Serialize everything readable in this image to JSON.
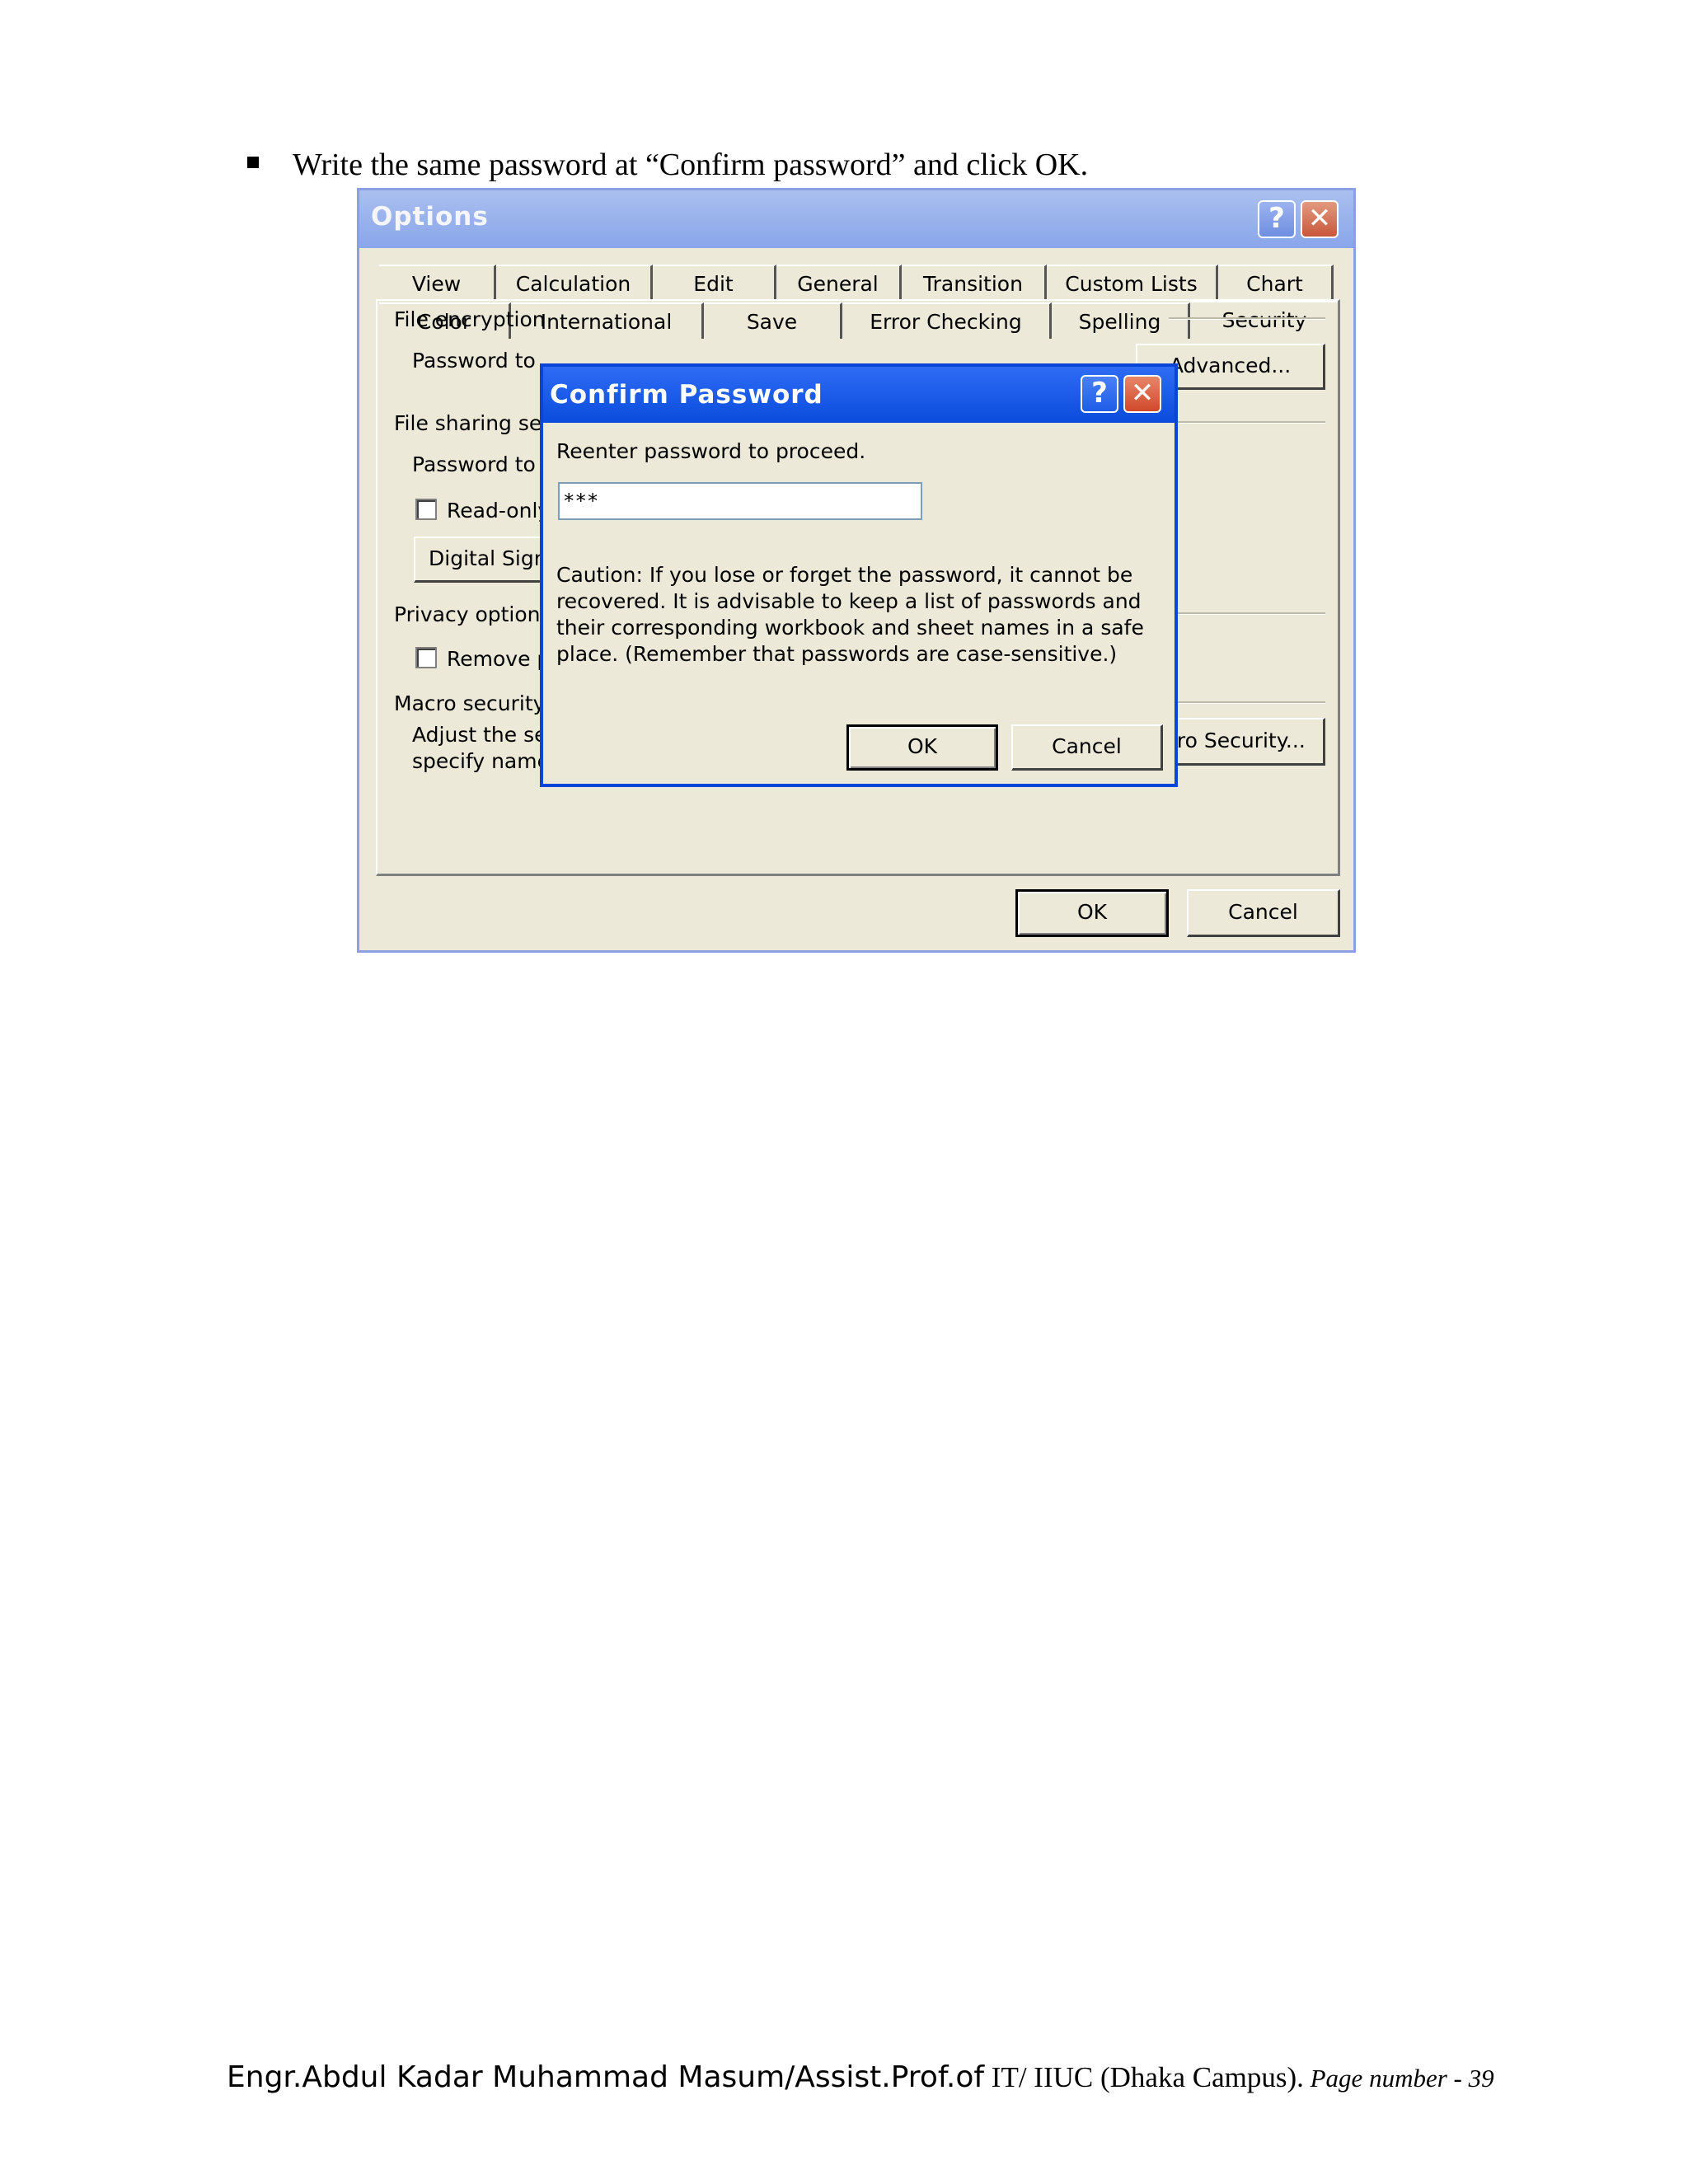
{
  "instruction": "Write the same password at “Confirm password” and click OK.",
  "options_dialog": {
    "title": "Options",
    "tabs_row1": [
      "View",
      "Calculation",
      "Edit",
      "General",
      "Transition",
      "Custom Lists",
      "Chart"
    ],
    "tabs_row2": [
      "Color",
      "International",
      "Save",
      "Error Checking",
      "Spelling",
      "Security"
    ],
    "active_tab": "Security",
    "file_encryption_label": "File encryption",
    "password_to_open_label": "Password to",
    "advanced_button": "Advanced...",
    "file_sharing_label": "File sharing set",
    "password_to_modify_label": "Password to",
    "read_only_label": "Read-only",
    "digital_signatures_button": "Digital Signa",
    "privacy_label": "Privacy options",
    "remove_label": "Remove p",
    "macro_security_label": "Macro security",
    "macro_description_line1": "Adjust the security level for files that might contain macro viruses and",
    "macro_description_line2": "specify names of trusted macro developers.",
    "macro_security_button": "Macro Security...",
    "ok_button": "OK",
    "cancel_button": "Cancel"
  },
  "confirm_dialog": {
    "title": "Confirm Password",
    "prompt": "Reenter password to proceed.",
    "password_value": "***",
    "caution_line1": "Caution: If you lose or forget the password, it cannot be",
    "caution_line2": "recovered. It is advisable to keep a list of passwords and",
    "caution_line3": "their corresponding workbook and sheet names in a safe",
    "caution_line4": "place.  (Remember that passwords are case-sensitive.)",
    "ok_button": "OK",
    "cancel_button": "Cancel"
  },
  "footer": {
    "author": "Engr.Abdul Kadar Muhammad Masum/Assist.Prof.of",
    "org": " IT/ IIUC (Dhaka Campus).",
    "page": " Page number - 39"
  },
  "colors": {
    "dialog_face": "#ECE9D8",
    "active_titlebar": "#0B4CDC",
    "inactive_titlebar": "#8AA6EA",
    "close_button": "#C8573A"
  }
}
